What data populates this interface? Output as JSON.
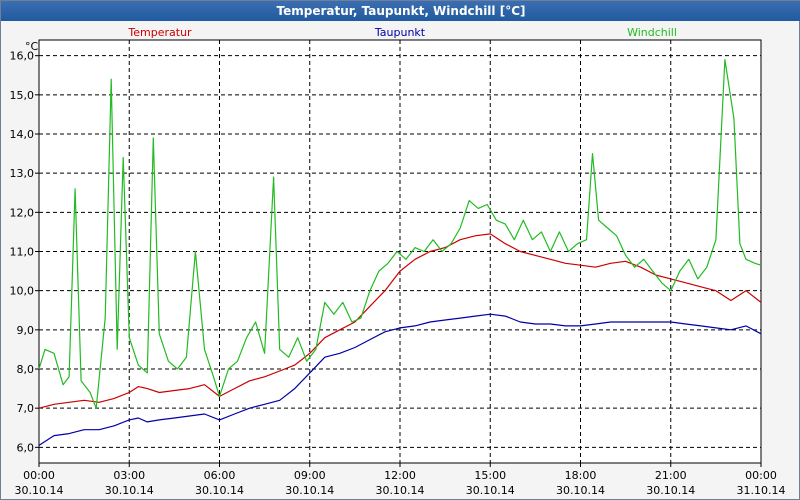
{
  "window": {
    "title": "Temperatur, Taupunkt, Windchill [°C]"
  },
  "colors": {
    "temperatur": "#cc0000",
    "taupunkt": "#0000aa",
    "windchill": "#22bb22",
    "grid": "#000000"
  },
  "chart_data": {
    "type": "line",
    "title": "Temperatur, Taupunkt, Windchill [°C]",
    "ylabel": "°C",
    "xlabel": "",
    "ylim": [
      5.6,
      16.4
    ],
    "grid": true,
    "legend_position": "top",
    "y_ticks": [
      "6,0",
      "7,0",
      "8,0",
      "9,0",
      "10,0",
      "11,0",
      "12,0",
      "13,0",
      "14,0",
      "15,0",
      "16,0"
    ],
    "x_ticks": [
      {
        "time": "00:00",
        "date": "30.10.14"
      },
      {
        "time": "03:00",
        "date": "30.10.14"
      },
      {
        "time": "06:00",
        "date": "30.10.14"
      },
      {
        "time": "09:00",
        "date": "30.10.14"
      },
      {
        "time": "12:00",
        "date": "30.10.14"
      },
      {
        "time": "15:00",
        "date": "30.10.14"
      },
      {
        "time": "18:00",
        "date": "30.10.14"
      },
      {
        "time": "21:00",
        "date": "30.10.14"
      },
      {
        "time": "00:00",
        "date": "31.10.14"
      }
    ],
    "x_unit": "hours since 30.10.14 00:00",
    "series": [
      {
        "name": "Temperatur",
        "color": "#cc0000",
        "points": [
          [
            0,
            7.0
          ],
          [
            0.5,
            7.1
          ],
          [
            1,
            7.15
          ],
          [
            1.5,
            7.2
          ],
          [
            2,
            7.15
          ],
          [
            2.5,
            7.25
          ],
          [
            3,
            7.4
          ],
          [
            3.3,
            7.55
          ],
          [
            3.6,
            7.5
          ],
          [
            4,
            7.4
          ],
          [
            4.5,
            7.45
          ],
          [
            5,
            7.5
          ],
          [
            5.5,
            7.6
          ],
          [
            6,
            7.3
          ],
          [
            6.5,
            7.5
          ],
          [
            7,
            7.7
          ],
          [
            7.5,
            7.8
          ],
          [
            8,
            7.95
          ],
          [
            8.5,
            8.1
          ],
          [
            9,
            8.4
          ],
          [
            9.5,
            8.8
          ],
          [
            10,
            9.0
          ],
          [
            10.5,
            9.2
          ],
          [
            11,
            9.6
          ],
          [
            11.5,
            10.0
          ],
          [
            12,
            10.5
          ],
          [
            12.5,
            10.8
          ],
          [
            13,
            11.0
          ],
          [
            13.5,
            11.1
          ],
          [
            14,
            11.3
          ],
          [
            14.5,
            11.4
          ],
          [
            15,
            11.45
          ],
          [
            15.5,
            11.2
          ],
          [
            16,
            11.0
          ],
          [
            16.5,
            10.9
          ],
          [
            17,
            10.8
          ],
          [
            17.5,
            10.7
          ],
          [
            18,
            10.65
          ],
          [
            18.5,
            10.6
          ],
          [
            19,
            10.7
          ],
          [
            19.5,
            10.75
          ],
          [
            20,
            10.6
          ],
          [
            20.5,
            10.4
          ],
          [
            21,
            10.3
          ],
          [
            21.5,
            10.2
          ],
          [
            22,
            10.1
          ],
          [
            22.5,
            10.0
          ],
          [
            23,
            9.75
          ],
          [
            23.5,
            10.0
          ],
          [
            24,
            9.7
          ]
        ]
      },
      {
        "name": "Taupunkt",
        "color": "#0000aa",
        "points": [
          [
            0,
            6.05
          ],
          [
            0.5,
            6.3
          ],
          [
            1,
            6.35
          ],
          [
            1.5,
            6.45
          ],
          [
            2,
            6.45
          ],
          [
            2.5,
            6.55
          ],
          [
            3,
            6.7
          ],
          [
            3.3,
            6.75
          ],
          [
            3.6,
            6.65
          ],
          [
            4,
            6.7
          ],
          [
            4.5,
            6.75
          ],
          [
            5,
            6.8
          ],
          [
            5.5,
            6.85
          ],
          [
            6,
            6.7
          ],
          [
            6.5,
            6.85
          ],
          [
            7,
            7.0
          ],
          [
            7.5,
            7.1
          ],
          [
            8,
            7.2
          ],
          [
            8.5,
            7.5
          ],
          [
            9,
            7.9
          ],
          [
            9.5,
            8.3
          ],
          [
            10,
            8.4
          ],
          [
            10.5,
            8.55
          ],
          [
            11,
            8.75
          ],
          [
            11.5,
            8.95
          ],
          [
            12,
            9.05
          ],
          [
            12.5,
            9.1
          ],
          [
            13,
            9.2
          ],
          [
            13.5,
            9.25
          ],
          [
            14,
            9.3
          ],
          [
            14.5,
            9.35
          ],
          [
            15,
            9.4
          ],
          [
            15.5,
            9.35
          ],
          [
            16,
            9.2
          ],
          [
            16.5,
            9.15
          ],
          [
            17,
            9.15
          ],
          [
            17.5,
            9.1
          ],
          [
            18,
            9.1
          ],
          [
            18.5,
            9.15
          ],
          [
            19,
            9.2
          ],
          [
            19.5,
            9.2
          ],
          [
            20,
            9.2
          ],
          [
            20.5,
            9.2
          ],
          [
            21,
            9.2
          ],
          [
            21.5,
            9.15
          ],
          [
            22,
            9.1
          ],
          [
            22.5,
            9.05
          ],
          [
            23,
            9.0
          ],
          [
            23.5,
            9.1
          ],
          [
            24,
            8.9
          ]
        ]
      },
      {
        "name": "Windchill",
        "color": "#22bb22",
        "points": [
          [
            0,
            8.0
          ],
          [
            0.2,
            8.5
          ],
          [
            0.5,
            8.4
          ],
          [
            0.8,
            7.6
          ],
          [
            1.0,
            7.8
          ],
          [
            1.2,
            12.6
          ],
          [
            1.4,
            7.7
          ],
          [
            1.7,
            7.4
          ],
          [
            1.9,
            7.0
          ],
          [
            2.2,
            9.3
          ],
          [
            2.4,
            15.4
          ],
          [
            2.6,
            8.5
          ],
          [
            2.8,
            13.4
          ],
          [
            3.0,
            8.8
          ],
          [
            3.3,
            8.1
          ],
          [
            3.6,
            7.9
          ],
          [
            3.8,
            13.9
          ],
          [
            4.0,
            8.9
          ],
          [
            4.3,
            8.2
          ],
          [
            4.6,
            8.0
          ],
          [
            4.9,
            8.3
          ],
          [
            5.2,
            11.0
          ],
          [
            5.5,
            8.5
          ],
          [
            5.8,
            7.8
          ],
          [
            6.0,
            7.3
          ],
          [
            6.3,
            8.0
          ],
          [
            6.6,
            8.2
          ],
          [
            6.9,
            8.8
          ],
          [
            7.2,
            9.2
          ],
          [
            7.5,
            8.4
          ],
          [
            7.8,
            12.9
          ],
          [
            8.0,
            8.5
          ],
          [
            8.3,
            8.3
          ],
          [
            8.6,
            8.8
          ],
          [
            8.9,
            8.2
          ],
          [
            9.2,
            8.5
          ],
          [
            9.5,
            9.7
          ],
          [
            9.8,
            9.4
          ],
          [
            10.1,
            9.7
          ],
          [
            10.4,
            9.2
          ],
          [
            10.7,
            9.3
          ],
          [
            11.0,
            10.0
          ],
          [
            11.3,
            10.5
          ],
          [
            11.6,
            10.7
          ],
          [
            11.9,
            11.0
          ],
          [
            12.2,
            10.8
          ],
          [
            12.5,
            11.1
          ],
          [
            12.8,
            11.0
          ],
          [
            13.1,
            11.3
          ],
          [
            13.4,
            11.0
          ],
          [
            13.7,
            11.2
          ],
          [
            14.0,
            11.6
          ],
          [
            14.3,
            12.3
          ],
          [
            14.6,
            12.1
          ],
          [
            14.9,
            12.2
          ],
          [
            15.2,
            11.8
          ],
          [
            15.5,
            11.7
          ],
          [
            15.8,
            11.3
          ],
          [
            16.1,
            11.8
          ],
          [
            16.4,
            11.3
          ],
          [
            16.7,
            11.5
          ],
          [
            17.0,
            11.0
          ],
          [
            17.3,
            11.5
          ],
          [
            17.6,
            11.0
          ],
          [
            17.9,
            11.2
          ],
          [
            18.2,
            11.3
          ],
          [
            18.4,
            13.5
          ],
          [
            18.6,
            11.8
          ],
          [
            18.9,
            11.6
          ],
          [
            19.2,
            11.4
          ],
          [
            19.5,
            10.9
          ],
          [
            19.8,
            10.6
          ],
          [
            20.1,
            10.8
          ],
          [
            20.4,
            10.5
          ],
          [
            20.7,
            10.2
          ],
          [
            21.0,
            10.0
          ],
          [
            21.3,
            10.5
          ],
          [
            21.6,
            10.8
          ],
          [
            21.9,
            10.3
          ],
          [
            22.2,
            10.6
          ],
          [
            22.5,
            11.3
          ],
          [
            22.8,
            15.9
          ],
          [
            23.1,
            14.4
          ],
          [
            23.3,
            11.2
          ],
          [
            23.5,
            10.8
          ],
          [
            23.8,
            10.7
          ],
          [
            24.0,
            10.65
          ]
        ]
      }
    ]
  }
}
